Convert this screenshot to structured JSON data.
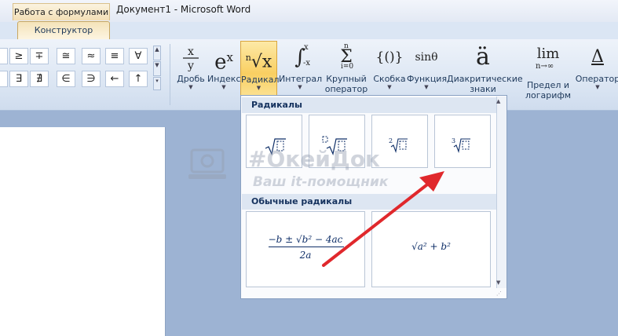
{
  "window": {
    "context_tab": "Работа с формулами",
    "title": "Документ1 - Microsoft Word"
  },
  "tabs": {
    "active": "Конструктор"
  },
  "symbols": {
    "row1": [
      "≥",
      "∓",
      "≅",
      "≈",
      "≡",
      "∀"
    ],
    "row2": [
      "∃",
      "∄",
      "∈",
      "∋",
      "←",
      "↑"
    ]
  },
  "ribbon": {
    "buttons": [
      {
        "id": "fraction",
        "glyph": "x/y",
        "label1": "Дробь",
        "label2": ""
      },
      {
        "id": "script",
        "glyph": "eˣ",
        "label1": "Индекс",
        "label2": ""
      },
      {
        "id": "radical",
        "glyph": "ⁿ√x",
        "label1": "Радикал",
        "label2": ""
      },
      {
        "id": "integral",
        "glyph": "∫",
        "label1": "Интеграл",
        "label2": ""
      },
      {
        "id": "large-operator",
        "glyph": "Σ",
        "label1": "Крупный",
        "label2": "оператор"
      },
      {
        "id": "bracket",
        "glyph": "{()}",
        "label1": "Скобка",
        "label2": ""
      },
      {
        "id": "function",
        "glyph": "sinθ",
        "label1": "Функция",
        "label2": ""
      },
      {
        "id": "accent",
        "glyph": "ä",
        "label1": "Диакритические",
        "label2": "знаки"
      },
      {
        "id": "limit-log",
        "glyph": "lim",
        "label1": "Предел и",
        "label2": "логарифм"
      },
      {
        "id": "operator",
        "glyph": "Δ",
        "label1": "Оператор",
        "label2": ""
      }
    ],
    "limit_sub": "n→∞",
    "integral_upper": "x",
    "integral_lower": "-x",
    "sum_upper": "n",
    "sum_lower": "i=0"
  },
  "gallery": {
    "section1": "Радикалы",
    "section2": "Обычные радикалы",
    "radicals": [
      {
        "name": "square-root",
        "index": ""
      },
      {
        "name": "nth-root",
        "index": ""
      },
      {
        "name": "square-root-degree",
        "index": "2"
      },
      {
        "name": "cube-root",
        "index": "3"
      }
    ],
    "common": [
      {
        "name": "quadratic-formula",
        "numerator": "−b ± √b² − 4ac",
        "denominator": "2a"
      },
      {
        "name": "pythagorean-root",
        "expression": "√a² + b²"
      }
    ]
  },
  "watermark": {
    "line1": "#ОкейДок",
    "line2": "Ваш it-помощник"
  },
  "colors": {
    "accent_highlight": "#f9cf62",
    "annotation_arrow": "#e0282c",
    "ribbon_text": "#1e395b"
  }
}
